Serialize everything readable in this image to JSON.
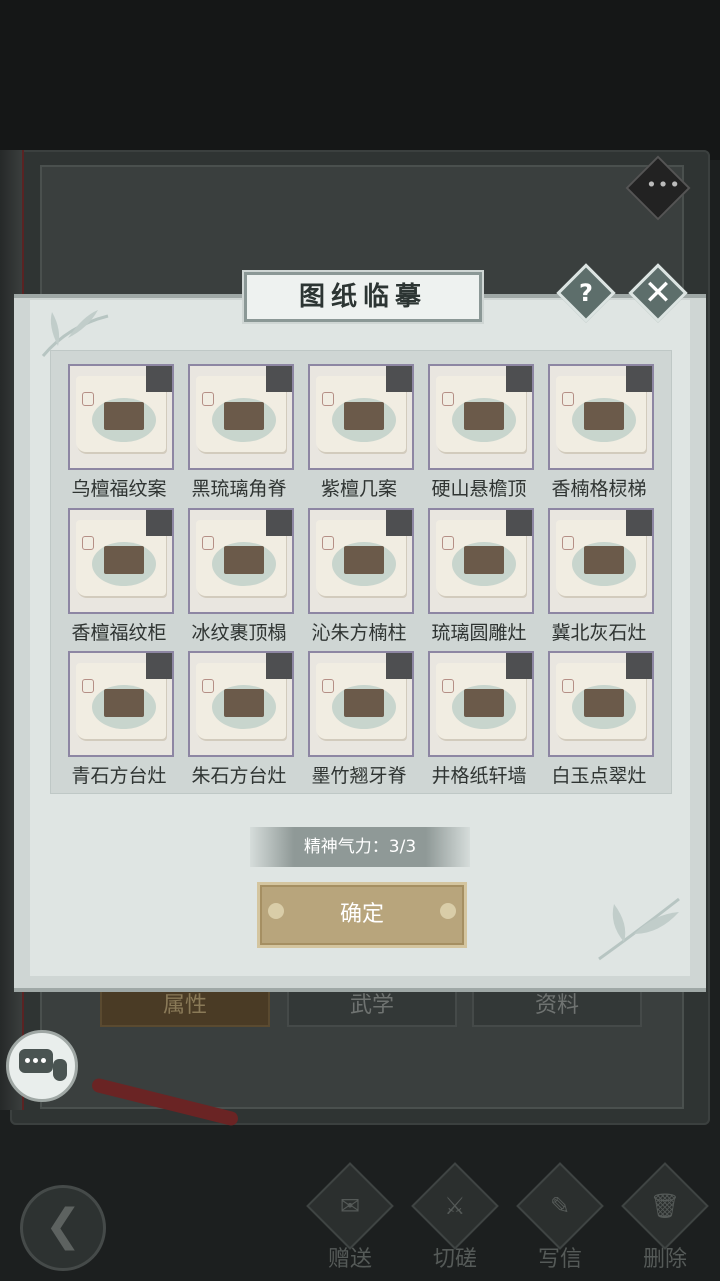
{
  "dialog": {
    "title": "图纸临摹",
    "help_icon_text": "?",
    "close_icon_text": "✕",
    "items": [
      {
        "name": "乌檀福纹案",
        "icon": "desk-icon"
      },
      {
        "name": "黑琉璃角脊",
        "icon": "roof-ridge-icon"
      },
      {
        "name": "紫檀几案",
        "icon": "table-icon"
      },
      {
        "name": "硬山悬檐顶",
        "icon": "pavilion-icon"
      },
      {
        "name": "香楠格棂梯",
        "icon": "shelf-icon"
      },
      {
        "name": "香檀福纹柜",
        "icon": "cabinet-icon"
      },
      {
        "name": "冰纹裹顶榻",
        "icon": "canopy-bed-icon"
      },
      {
        "name": "沁朱方楠柱",
        "icon": "pillar-icon"
      },
      {
        "name": "琉璃圆雕灶",
        "icon": "stove-icon"
      },
      {
        "name": "冀北灰石灶",
        "icon": "stove-icon"
      },
      {
        "name": "青石方台灶",
        "icon": "stove-icon"
      },
      {
        "name": "朱石方台灶",
        "icon": "stove-icon"
      },
      {
        "name": "墨竹翘牙脊",
        "icon": "roof-ridge-icon"
      },
      {
        "name": "井格纸轩墙",
        "icon": "wall-icon"
      },
      {
        "name": "白玉点翠灶",
        "icon": "stove-icon"
      }
    ],
    "energy_label": "精神气力：3/3",
    "confirm_label": "确定"
  },
  "background": {
    "tabs": [
      "属性",
      "武学",
      "资料"
    ],
    "actions": [
      {
        "label": "赠送",
        "icon": "scroll-icon"
      },
      {
        "label": "切磋",
        "icon": "sword-icon"
      },
      {
        "label": "写信",
        "icon": "letter-icon"
      },
      {
        "label": "删除",
        "icon": "trash-icon"
      }
    ],
    "menu_icon_text": "•••",
    "back_icon_text": "❮"
  }
}
